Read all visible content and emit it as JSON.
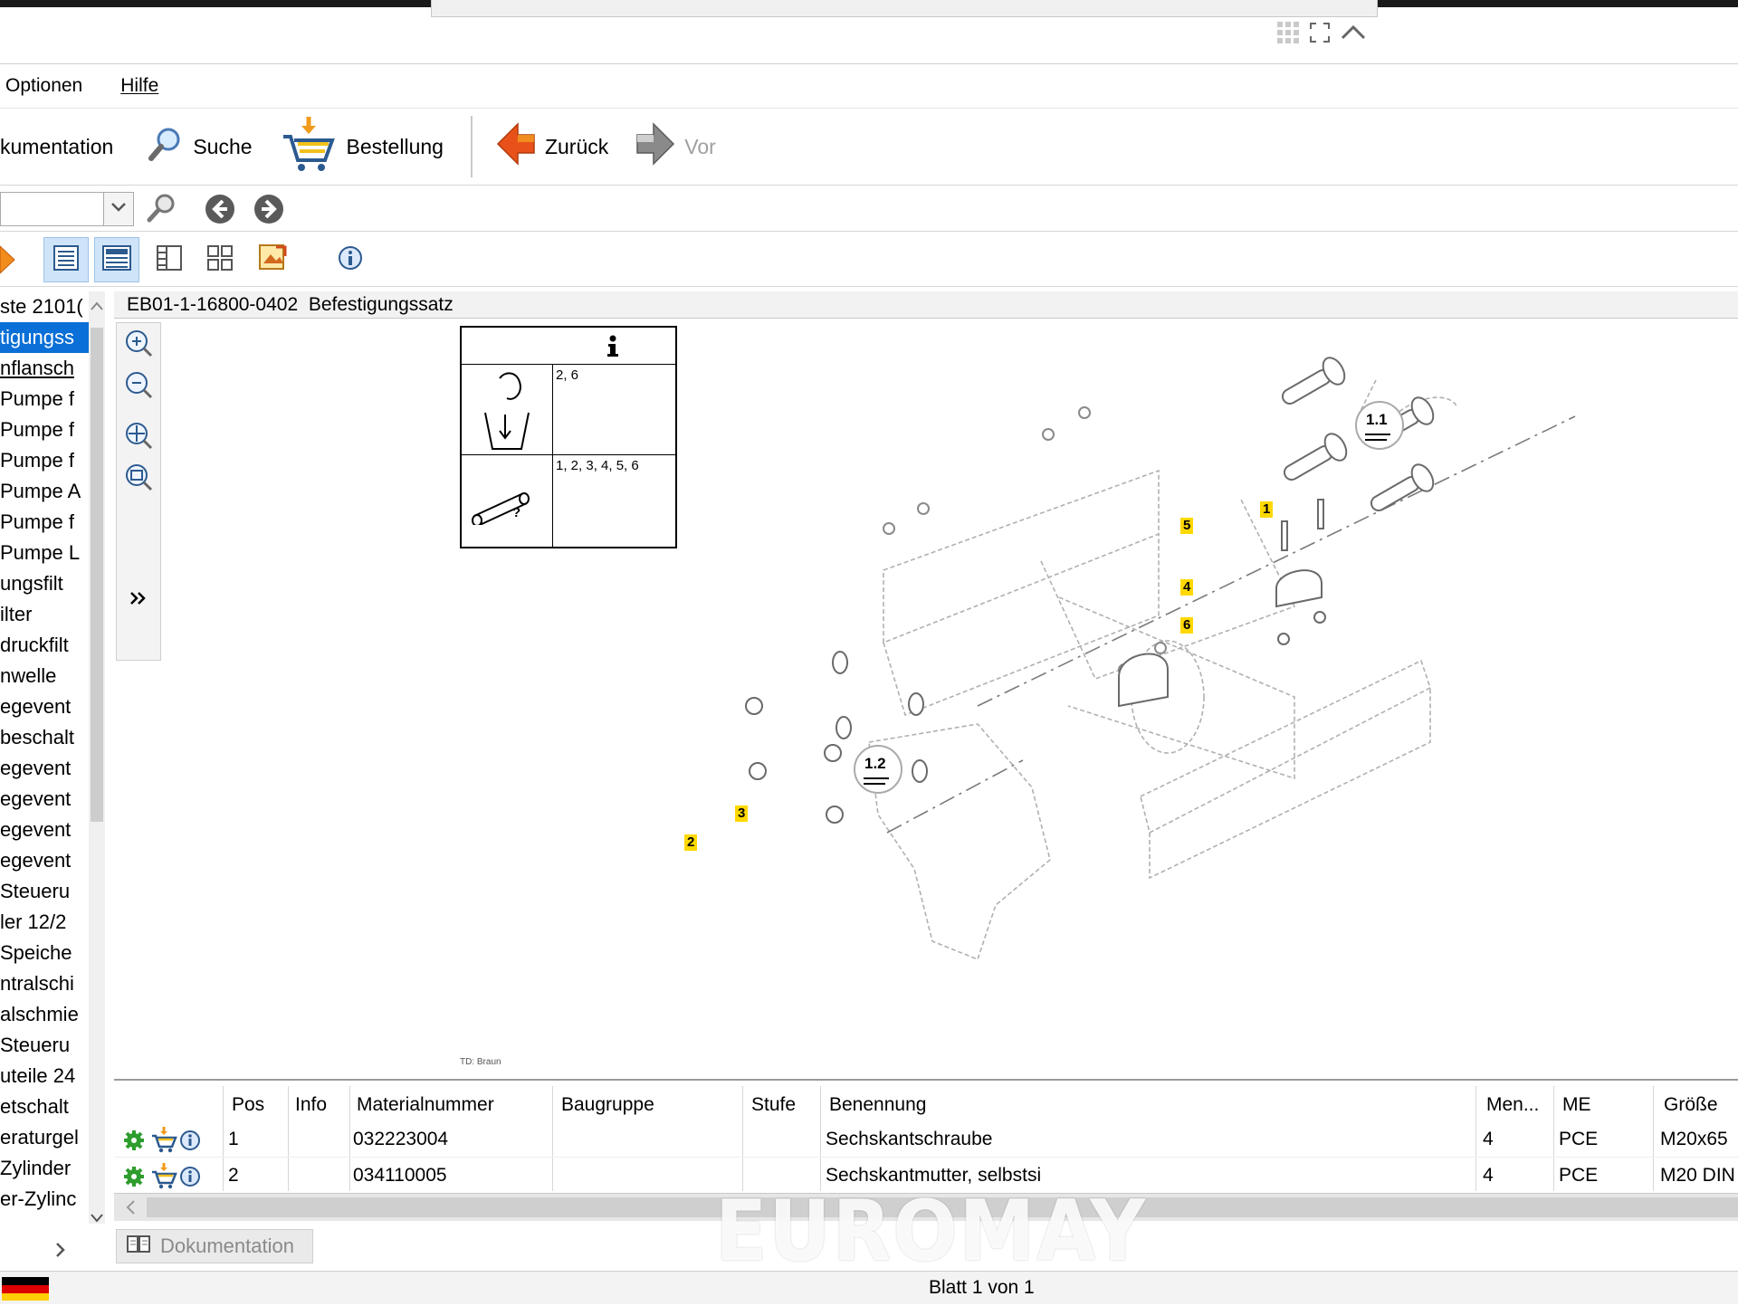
{
  "menu": [
    "Optionen",
    "Hilfe"
  ],
  "toolbar": {
    "dokumentation": "kumentation",
    "suche": "Suche",
    "bestellung": "Bestellung",
    "zurueck": "Zurück",
    "vor": "Vor"
  },
  "icons": {
    "search": "search-icon",
    "cart": "cart-icon",
    "back": "back-arrow-icon",
    "forward": "forward-arrow-icon",
    "info": "info-icon"
  },
  "tree": [
    "ste 2101(",
    "tigungss",
    "nflansch",
    "Pumpe f",
    "Pumpe f",
    "Pumpe f",
    "Pumpe A",
    "Pumpe f",
    "Pumpe L",
    "ungsfilt",
    "ilter",
    "druckfilt",
    "nwelle",
    "egevent",
    "beschalt",
    "egevent",
    "egevent",
    "egevent",
    "egevent",
    "Steueru",
    "ler 12/2",
    "Speiche",
    "ntralschi",
    "alschmie",
    "Steueru",
    "uteile 24",
    "etschalt",
    "eraturgel",
    "Zylinder",
    "er-Zylinc"
  ],
  "header": {
    "code": "EB01-1-16800-0402",
    "name": "Befestigungssatz"
  },
  "infobox": {
    "row1": "2, 6",
    "row2": "1, 2, 3, 4, 5, 6",
    "question": "?"
  },
  "drawing": {
    "callouts": [
      "1.1",
      "1.2"
    ],
    "labels": [
      "1",
      "2",
      "3",
      "4",
      "5",
      "6"
    ],
    "footer": "TD: Braun"
  },
  "table": {
    "columns": [
      "Pos",
      "Info",
      "Materialnummer",
      "Baugruppe",
      "Stufe",
      "Benennung",
      "Men...",
      "ME",
      "Größe"
    ],
    "rows": [
      {
        "pos": "1",
        "material": "032223004",
        "baugruppe": "",
        "stufe": "",
        "benennung": "Sechskantschraube",
        "menge": "4",
        "me": "PCE",
        "groesse": "M20x65"
      },
      {
        "pos": "2",
        "material": "034110005",
        "baugruppe": "",
        "stufe": "",
        "benennung": "Sechskantmutter, selbstsi",
        "menge": "4",
        "me": "PCE",
        "groesse": "M20 DIN"
      }
    ]
  },
  "doc_tab": "Dokumentation",
  "status": {
    "page": "Blatt 1 von 1"
  },
  "watermark": "EUROMAY",
  "colors": {
    "selection": "#0a6fd6",
    "label_bg": "#ffd800",
    "green": "#2e9d2e"
  }
}
